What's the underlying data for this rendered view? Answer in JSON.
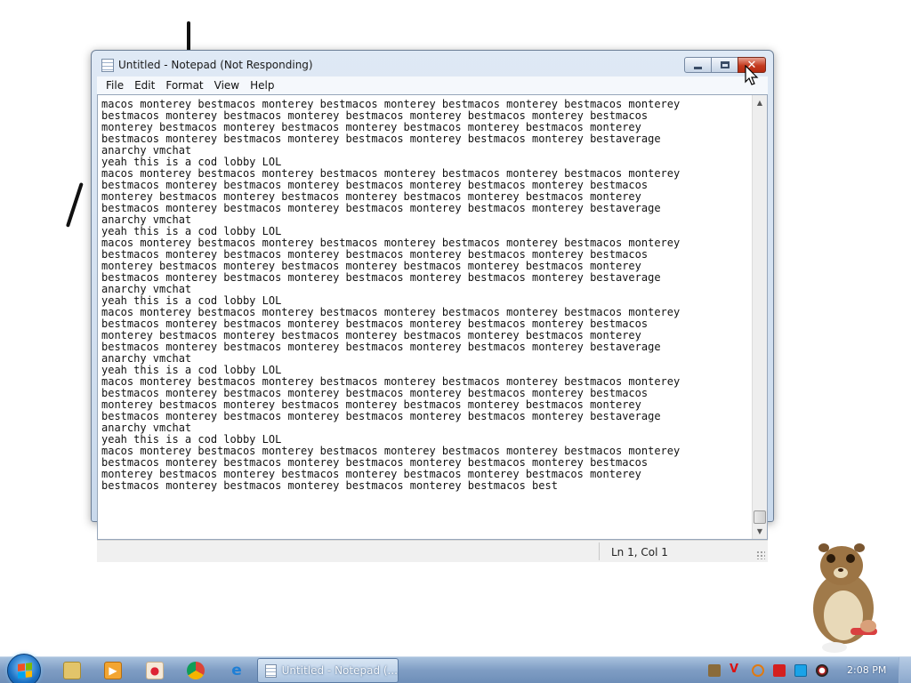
{
  "window": {
    "title": "Untitled - Notepad (Not Responding)",
    "buttons": {
      "minimize": "minimize-icon",
      "maximize": "maximize-icon",
      "close": "✕"
    }
  },
  "menu": {
    "items": [
      "File",
      "Edit",
      "Format",
      "View",
      "Help"
    ]
  },
  "editor": {
    "text": "macos monterey bestmacos monterey bestmacos monterey bestmacos monterey bestmacos monterey\nbestmacos monterey bestmacos monterey bestmacos monterey bestmacos monterey bestmacos\nmonterey bestmacos monterey bestmacos monterey bestmacos monterey bestmacos monterey\nbestmacos monterey bestmacos monterey bestmacos monterey bestmacos monterey bestaverage\nanarchy vmchat\nyeah this is a cod lobby LOL\nmacos monterey bestmacos monterey bestmacos monterey bestmacos monterey bestmacos monterey\nbestmacos monterey bestmacos monterey bestmacos monterey bestmacos monterey bestmacos\nmonterey bestmacos monterey bestmacos monterey bestmacos monterey bestmacos monterey\nbestmacos monterey bestmacos monterey bestmacos monterey bestmacos monterey bestaverage\nanarchy vmchat\nyeah this is a cod lobby LOL\nmacos monterey bestmacos monterey bestmacos monterey bestmacos monterey bestmacos monterey\nbestmacos monterey bestmacos monterey bestmacos monterey bestmacos monterey bestmacos\nmonterey bestmacos monterey bestmacos monterey bestmacos monterey bestmacos monterey\nbestmacos monterey bestmacos monterey bestmacos monterey bestmacos monterey bestaverage\nanarchy vmchat\nyeah this is a cod lobby LOL\nmacos monterey bestmacos monterey bestmacos monterey bestmacos monterey bestmacos monterey\nbestmacos monterey bestmacos monterey bestmacos monterey bestmacos monterey bestmacos\nmonterey bestmacos monterey bestmacos monterey bestmacos monterey bestmacos monterey\nbestmacos monterey bestmacos monterey bestmacos monterey bestmacos monterey bestaverage\nanarchy vmchat\nyeah this is a cod lobby LOL\nmacos monterey bestmacos monterey bestmacos monterey bestmacos monterey bestmacos monterey\nbestmacos monterey bestmacos monterey bestmacos monterey bestmacos monterey bestmacos\nmonterey bestmacos monterey bestmacos monterey bestmacos monterey bestmacos monterey\nbestmacos monterey bestmacos monterey bestmacos monterey bestmacos monterey bestaverage\nanarchy vmchat\nyeah this is a cod lobby LOL\nmacos monterey bestmacos monterey bestmacos monterey bestmacos monterey bestmacos monterey\nbestmacos monterey bestmacos monterey bestmacos monterey bestmacos monterey bestmacos\nmonterey bestmacos monterey bestmacos monterey bestmacos monterey bestmacos monterey\nbestmacos monterey bestmacos monterey bestmacos monterey bestmacos best"
  },
  "status": {
    "position": "Ln 1, Col 1"
  },
  "taskbar": {
    "pinned": [
      "explorer-icon",
      "media-player-icon",
      "paint-icon",
      "chrome-icon",
      "ie-icon"
    ],
    "task_label": "Untitled - Notepad (...",
    "tray": [
      "tray-app-icon",
      "antivirus-icon",
      "search-tool-icon",
      "flag-icon",
      "display-icon",
      "speaker-icon"
    ],
    "clock": "2:08 PM"
  },
  "colors": {
    "close_button": "#c43b20",
    "taskbar": "#7f9dc4",
    "accent": "#1a6fc2"
  }
}
